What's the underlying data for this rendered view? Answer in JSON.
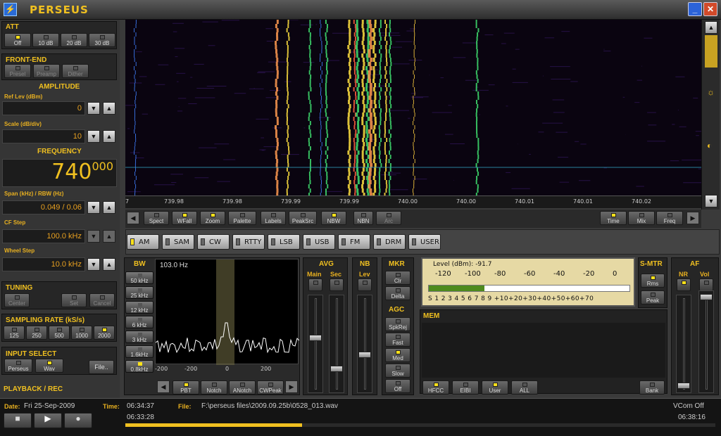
{
  "app": {
    "title": "PERSEUS"
  },
  "att": {
    "label": "ATT",
    "buttons": [
      {
        "label": "Off",
        "on": true
      },
      {
        "label": "10 dB",
        "on": false
      },
      {
        "label": "20 dB",
        "on": false
      },
      {
        "label": "30 dB",
        "on": false
      }
    ]
  },
  "frontend": {
    "label": "FRONT-END",
    "buttons": [
      {
        "label": "Presel",
        "on": false
      },
      {
        "label": "Preamp",
        "on": false
      },
      {
        "label": "Dither",
        "on": false
      }
    ]
  },
  "amplitude": {
    "label": "AMPLITUDE",
    "ref_label": "Ref Lev (dBm)",
    "ref_value": "0",
    "scale_label": "Scale (dB/div)",
    "scale_value": "10"
  },
  "frequency": {
    "label": "FREQUENCY",
    "main": "740",
    "fraction": "000",
    "span_label": "Span (kHz) / RBW (Hz)",
    "span_value": "0.049 / 0.06",
    "cf_label": "CF Step",
    "cf_value": "100.0 kHz",
    "wheel_label": "Wheel Step",
    "wheel_value": "10.0 kHz"
  },
  "tuning": {
    "label": "TUNING",
    "buttons": [
      "Center",
      "Set",
      "Cancel"
    ]
  },
  "sampling": {
    "label": "SAMPLING RATE (kS/s)",
    "buttons": [
      {
        "label": "125",
        "on": false
      },
      {
        "label": "250",
        "on": false
      },
      {
        "label": "500",
        "on": false
      },
      {
        "label": "1000",
        "on": false
      },
      {
        "label": "2000",
        "on": true
      }
    ]
  },
  "input": {
    "label": "INPUT SELECT",
    "buttons": [
      {
        "label": "Perseus",
        "on": false
      },
      {
        "label": "Wav",
        "on": true
      }
    ],
    "file_label": "File.."
  },
  "playback": {
    "label": "PLAYBACK / REC"
  },
  "waterfall": {
    "ticks": [
      "7",
      "739.98",
      "739.98",
      "739.99",
      "739.99",
      "740.00",
      "740.00",
      "740.01",
      "740.01",
      "740.02"
    ]
  },
  "toolbar": {
    "left": [
      {
        "label": "Spect",
        "on": false
      },
      {
        "label": "WFall",
        "on": true
      },
      {
        "label": "Zoom",
        "on": true
      },
      {
        "label": "Palette",
        "on": false
      },
      {
        "label": "Labels",
        "on": false
      },
      {
        "label": "PeakSrc",
        "on": false
      },
      {
        "label": "NBW",
        "on": true
      },
      {
        "label": "NBN",
        "on": false
      },
      {
        "label": "Arc",
        "on": false
      }
    ],
    "right": [
      {
        "label": "Time",
        "on": true
      },
      {
        "label": "Mix",
        "on": false
      },
      {
        "label": "Freq",
        "on": false
      }
    ]
  },
  "modes": [
    {
      "label": "AM",
      "on": true
    },
    {
      "label": "SAM",
      "on": false
    },
    {
      "label": "CW",
      "on": false
    },
    {
      "label": "RTTY",
      "on": false
    },
    {
      "label": "LSB",
      "on": false
    },
    {
      "label": "USB",
      "on": false
    },
    {
      "label": "FM",
      "on": false
    },
    {
      "label": "DRM",
      "on": false
    },
    {
      "label": "USER",
      "on": false
    }
  ],
  "bw": {
    "label": "BW",
    "buttons": [
      {
        "label": "50 kHz",
        "on": false
      },
      {
        "label": "25 kHz",
        "on": false
      },
      {
        "label": "12 kHz",
        "on": false
      },
      {
        "label": "6 kHz",
        "on": false
      },
      {
        "label": "3 kHz",
        "on": false
      },
      {
        "label": "1.6kHz",
        "on": false
      },
      {
        "label": "0.8kHz",
        "on": true
      }
    ],
    "readout": "103.0 Hz",
    "ticks": [
      "-200",
      "-200",
      "0",
      "200"
    ],
    "bottom": [
      {
        "label": "PBT",
        "on": true
      },
      {
        "label": "Notch",
        "on": false
      },
      {
        "label": "ANotch",
        "on": false
      },
      {
        "label": "CWPeak",
        "on": false
      }
    ]
  },
  "avg": {
    "label": "AVG",
    "main": "Main",
    "sec": "Sec"
  },
  "nb": {
    "label": "NB",
    "lev": "Lev"
  },
  "mkr": {
    "label": "MKR",
    "buttons": [
      "Clr",
      "Delta"
    ]
  },
  "agc": {
    "label": "AGC",
    "buttons": [
      {
        "label": "SpkRej",
        "on": false
      },
      {
        "label": "Fast",
        "on": false
      },
      {
        "label": "Med",
        "on": true
      },
      {
        "label": "Slow",
        "on": false
      },
      {
        "label": "Off",
        "on": false
      }
    ]
  },
  "smeter": {
    "level_text": "Level (dBm): -91.7",
    "dbm_ticks": [
      "-120",
      "-100",
      "-80",
      "-60",
      "-40",
      "-20",
      "0"
    ],
    "s_ticks": "S 1 2 3 4 5 6 7 8 9 +10+20+30+40+50+60+70",
    "level_dbm": -91.7
  },
  "smtr": {
    "label": "S-MTR",
    "buttons": [
      {
        "label": "Rms",
        "on": true
      },
      {
        "label": "Peak",
        "on": false
      }
    ]
  },
  "af": {
    "label": "AF",
    "nr": "NR",
    "vol": "Vol"
  },
  "mem": {
    "label": "MEM",
    "buttons": [
      {
        "label": "HFCC",
        "on": true
      },
      {
        "label": "EIBI",
        "on": false
      },
      {
        "label": "User",
        "on": true
      },
      {
        "label": "ALL",
        "on": false
      }
    ],
    "bank": "Bank"
  },
  "status": {
    "date_label": "Date:",
    "date": "Fri 25-Sep-2009",
    "time_label": "Time:",
    "time": "06:34:37",
    "file_label": "File:",
    "file": "F:\\perseus files\\2009.09.25b\\0528_013.wav",
    "vcom": "VCom Off",
    "start": "06:33:28",
    "end": "06:38:16",
    "progress": 0.3
  },
  "colors": {
    "accent": "#f0c020",
    "led": "#ffe21a"
  }
}
